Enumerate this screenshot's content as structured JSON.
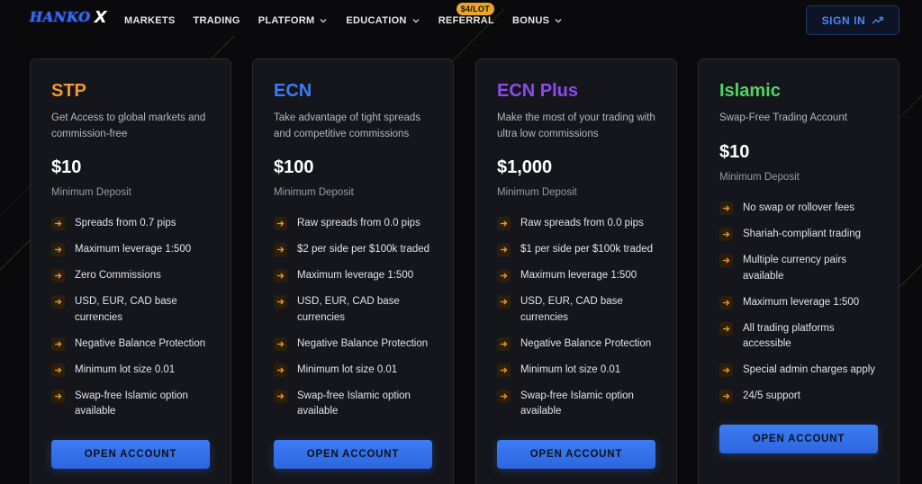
{
  "nav": {
    "logo_text": "HANKO",
    "logo_x": "X",
    "items": [
      {
        "label": "MARKETS",
        "dropdown": false
      },
      {
        "label": "TRADING",
        "dropdown": false
      },
      {
        "label": "PLATFORM",
        "dropdown": true
      },
      {
        "label": "EDUCATION",
        "dropdown": true
      },
      {
        "label": "REFERRAL",
        "dropdown": false,
        "badge": "$4/LOT"
      },
      {
        "label": "BONUS",
        "dropdown": true
      }
    ],
    "signin_label": "SIGN IN"
  },
  "colors": {
    "accent_blue": "#3d7cf2",
    "stp": "#f29a2a",
    "ecn": "#3d7cf2",
    "ecn_plus": "#8a4cf0",
    "islamic": "#52d36a",
    "arrow": "#f09a2a"
  },
  "cards": [
    {
      "title": "STP",
      "title_color": "#f29a2a",
      "desc": "Get Access to global markets and commission-free",
      "price": "$10",
      "min_deposit": "Minimum Deposit",
      "features": [
        "Spreads from 0.7 pips",
        "Maximum leverage 1:500",
        "Zero Commissions",
        "USD, EUR, CAD base currencies",
        "Negative Balance Protection",
        "Minimum lot size 0.01",
        "Swap-free Islamic option available"
      ],
      "button": "OPEN ACCOUNT"
    },
    {
      "title": "ECN",
      "title_color": "#3d7cf2",
      "desc": "Take advantage of tight spreads and competitive commissions",
      "price": "$100",
      "min_deposit": "Minimum Deposit",
      "features": [
        "Raw spreads from 0.0 pips",
        "$2 per side per $100k traded",
        "Maximum leverage 1:500",
        "USD, EUR, CAD base currencies",
        "Negative Balance Protection",
        "Minimum lot size 0.01",
        "Swap-free Islamic option available"
      ],
      "button": "OPEN ACCOUNT"
    },
    {
      "title": "ECN Plus",
      "title_color": "#8a4cf0",
      "desc": "Make the most of your trading with ultra low commissions",
      "price": "$1,000",
      "min_deposit": "Minimum Deposit",
      "features": [
        "Raw spreads from 0.0 pips",
        "$1 per side per $100k traded",
        "Maximum leverage 1:500",
        "USD, EUR, CAD base currencies",
        "Negative Balance Protection",
        "Minimum lot size 0.01",
        "Swap-free Islamic option available"
      ],
      "button": "OPEN ACCOUNT"
    },
    {
      "title": "Islamic",
      "title_color": "#52d36a",
      "desc": "Swap-Free Trading Account",
      "price": "$10",
      "min_deposit": "Minimum Deposit",
      "features": [
        "No swap or rollover fees",
        "Shariah-compliant trading",
        "Multiple currency pairs available",
        "Maximum leverage 1:500",
        "All trading platforms accessible",
        "Special admin charges apply",
        "24/5 support"
      ],
      "button": "OPEN ACCOUNT"
    }
  ]
}
